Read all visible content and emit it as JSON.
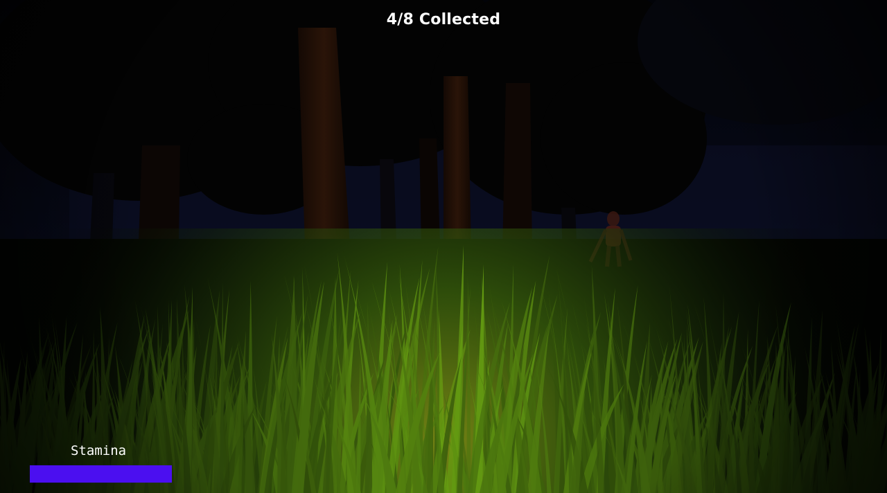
{
  "hud": {
    "collected_text": "4/8 Collected",
    "stamina_label": "Stamina",
    "stamina_level": 1.0,
    "stamina_color": "#4b0ff0"
  },
  "scene": {
    "description_icons": [
      "forest-trees",
      "tall-grass",
      "creature-figure"
    ],
    "ambient_color": "#05070f",
    "grass_color": "#5a8f12"
  }
}
